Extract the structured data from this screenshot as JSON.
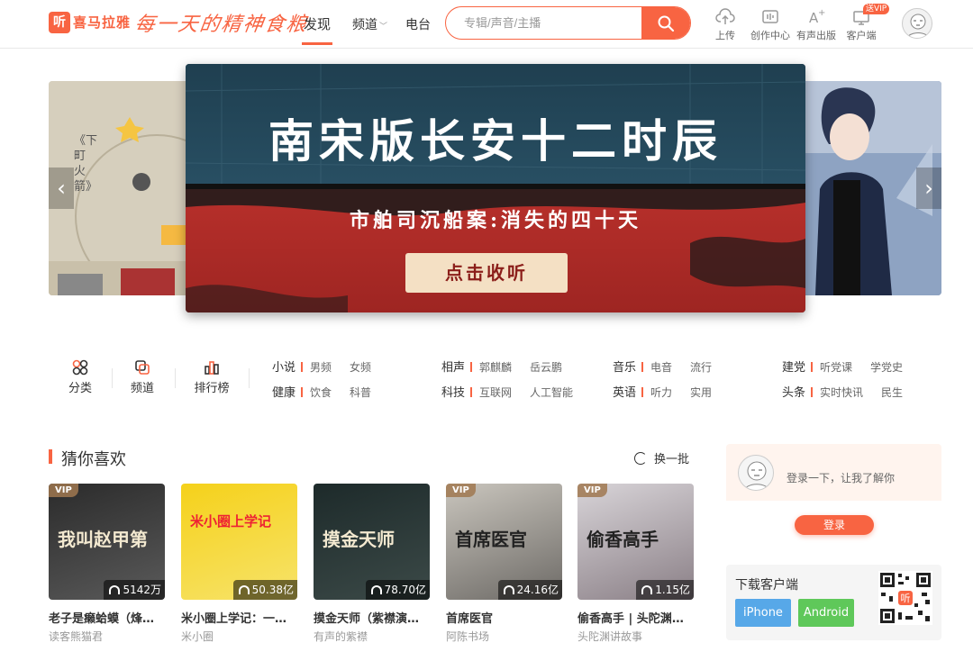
{
  "header": {
    "logo_glyph": "听",
    "logo_text": "喜马拉雅",
    "slogan": "每一天的精神食粮",
    "nav": [
      {
        "label": "发现",
        "active": true
      },
      {
        "label": "频道"
      },
      {
        "label": "电台"
      }
    ],
    "search": {
      "placeholder": "专辑/声音/主播"
    },
    "tools": [
      {
        "label": "上传",
        "icon": "upload-cloud-icon"
      },
      {
        "label": "创作中心",
        "icon": "creator-center-icon"
      },
      {
        "label": "有声出版",
        "icon": "publish-icon"
      },
      {
        "label": "客户端",
        "icon": "desktop-client-icon",
        "badge": "送VIP"
      }
    ]
  },
  "banner": {
    "title": "南宋版长安十二时辰",
    "subtitle": "市舶司沉船案:消失的四十天",
    "cta": "点击收听",
    "left_slide_vertical_text": "《下町火箭》"
  },
  "categories": {
    "quick": [
      {
        "label": "分类",
        "icon": "grid-dots-icon"
      },
      {
        "label": "频道",
        "icon": "channel-icon"
      },
      {
        "label": "排行榜",
        "icon": "ranking-icon"
      }
    ],
    "groups": [
      {
        "rows": [
          {
            "main": "小说",
            "subs": [
              "男频",
              "女频"
            ]
          },
          {
            "main": "健康",
            "subs": [
              "饮食",
              "科普"
            ]
          }
        ]
      },
      {
        "rows": [
          {
            "main": "相声",
            "subs": [
              "郭麒麟",
              "岳云鹏"
            ]
          },
          {
            "main": "科技",
            "subs": [
              "互联网",
              "人工智能"
            ]
          }
        ]
      },
      {
        "rows": [
          {
            "main": "音乐",
            "subs": [
              "电音",
              "流行"
            ]
          },
          {
            "main": "英语",
            "subs": [
              "听力",
              "实用"
            ]
          }
        ]
      },
      {
        "rows": [
          {
            "main": "建党",
            "subs": [
              "听党课",
              "学党史"
            ]
          },
          {
            "main": "头条",
            "subs": [
              "实时快讯",
              "民生"
            ]
          }
        ]
      }
    ]
  },
  "recommend": {
    "title": "猜你喜欢",
    "refresh_label": "换一批",
    "items": [
      {
        "title": "老子是癞蛤蟆（烽火…",
        "author": "读客熊猫君",
        "plays": "5142万",
        "vip": "VIP",
        "cover_text": "我叫赵甲第",
        "colors": [
          "#2b2b2b",
          "#5a5a5a"
        ]
      },
      {
        "title": "米小圈上学记：一二…",
        "author": "米小圈",
        "plays": "50.38亿",
        "vip": "",
        "cover_text": "米小圈上学记",
        "colors": [
          "#f5d11a",
          "#f7e36a"
        ]
      },
      {
        "title": "摸金天师（紫襟演播）",
        "author": "有声的紫襟",
        "plays": "78.70亿",
        "vip": "",
        "cover_text": "摸金天师",
        "colors": [
          "#1d2a2a",
          "#3c4a48"
        ]
      },
      {
        "title": "首席医官",
        "author": "阿陈书场",
        "plays": "24.16亿",
        "vip": "VIP",
        "cover_text": "首席医官",
        "colors": [
          "#c9c5bd",
          "#6d6a66"
        ]
      },
      {
        "title": "偷香高手 | 头陀渊工…",
        "author": "头陀渊讲故事",
        "plays": "1.15亿",
        "vip": "VIP",
        "cover_text": "偷香高手",
        "colors": [
          "#d8d4d8",
          "#8a7f86"
        ]
      }
    ]
  },
  "sidebar": {
    "login_tip": "登录一下，让我了解你",
    "login_button": "登录",
    "download_title": "下载客户端",
    "iphone_label": "iPhone",
    "android_label": "Android",
    "accent": "#f86442",
    "iphone_color": "#57a8e8",
    "android_color": "#5fc85a"
  }
}
